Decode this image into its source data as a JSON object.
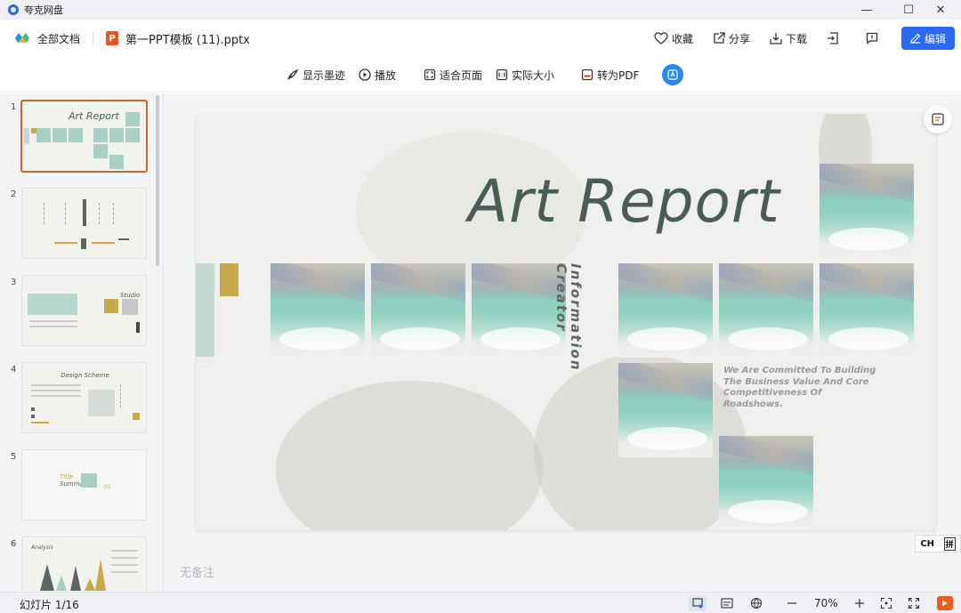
{
  "app": {
    "name": "夸克网盘",
    "window_controls": {
      "minimize": "—",
      "maximize": "☐",
      "close": "✕"
    }
  },
  "header": {
    "all_docs": "全部文档",
    "file_badge": "P",
    "file_name": "第一PPT模板 (11).pptx",
    "favorite": "收藏",
    "share": "分享",
    "download": "下载",
    "edit": "编辑",
    "accent_color": "#2a6af3"
  },
  "toolbar": {
    "show_ink": "显示墨迹",
    "play": "播放",
    "fit_page": "适合页面",
    "actual_size": "实际大小",
    "to_pdf": "转为PDF"
  },
  "thumbnails": {
    "numbers": [
      "1",
      "2",
      "3",
      "4",
      "5",
      "6"
    ],
    "active_index": 1,
    "previews": {
      "t1_title": "Art Report",
      "t3_title": "Studio",
      "t4_title": "Design Scheme",
      "t5_title": "Title",
      "t5_sub": "Summary",
      "t5_num": "01",
      "t6_title": "Analysis"
    }
  },
  "slide": {
    "title": "Art Report",
    "vertical_line1": "Creator",
    "vertical_line2": "Information",
    "tagline": "We Are Committed To Building The Business Value And Core Competitiveness Of Roadshows."
  },
  "notes_placeholder": "无备注",
  "ime": {
    "lang": "CH",
    "mode": "拼"
  },
  "status": {
    "slide_counter": "幻灯片 1/16",
    "zoom": "70%"
  }
}
